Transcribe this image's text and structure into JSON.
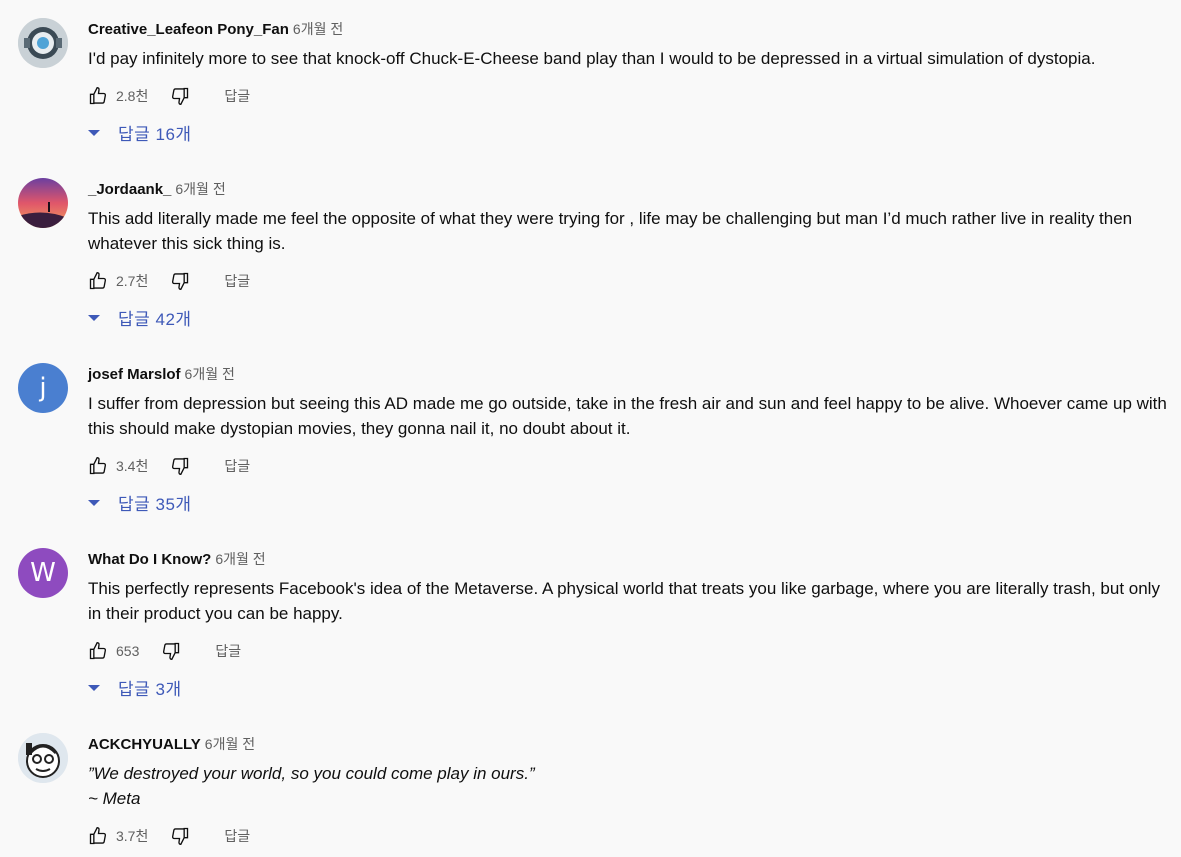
{
  "reply_label": "답글",
  "comments": [
    {
      "author": "Creative_Leafeon Pony_Fan",
      "time": "6개월 전",
      "text": "I'd pay infinitely more to see that knock-off Chuck-E-Cheese band play than I would to be depressed in a virtual simulation of dystopia.",
      "likes": "2.8천",
      "replies": "답글 16개",
      "avatar_icon": "robot-avatar-icon"
    },
    {
      "author": "_Jordaank_",
      "time": "6개월 전",
      "text": "This add literally made me feel the opposite of what they were trying for , life may be challenging but man I’d much rather live in reality then whatever this sick thing is.",
      "likes": "2.7천",
      "replies": "답글 42개",
      "avatar_icon": "sunset-avatar-icon"
    },
    {
      "author": "josef Marslof",
      "time": "6개월 전",
      "text": "I suffer from depression but seeing this AD made me go outside, take in the fresh air and sun and feel happy to be alive. Whoever came up with this should make dystopian movies, they gonna nail it, no doubt about it.",
      "likes": "3.4천",
      "replies": "답글 35개",
      "avatar_letter": "j",
      "avatar_color": "#4a7fd0"
    },
    {
      "author": "What Do I Know?",
      "time": "6개월 전",
      "text": "This perfectly represents Facebook's idea of the Metaverse.  A physical world that treats you like garbage, where you are literally trash, but only in their product you can be happy.",
      "likes": "653",
      "replies": "답글 3개",
      "avatar_letter": "W",
      "avatar_color": "#8e4bbf"
    },
    {
      "author": "ACKCHYUALLY",
      "time": "6개월 전",
      "text_line1": "”We destroyed your world, so you could come play in ours.”",
      "text_line2": "~ Meta",
      "likes": "3.7천",
      "avatar_icon": "meme-face-avatar-icon"
    }
  ]
}
